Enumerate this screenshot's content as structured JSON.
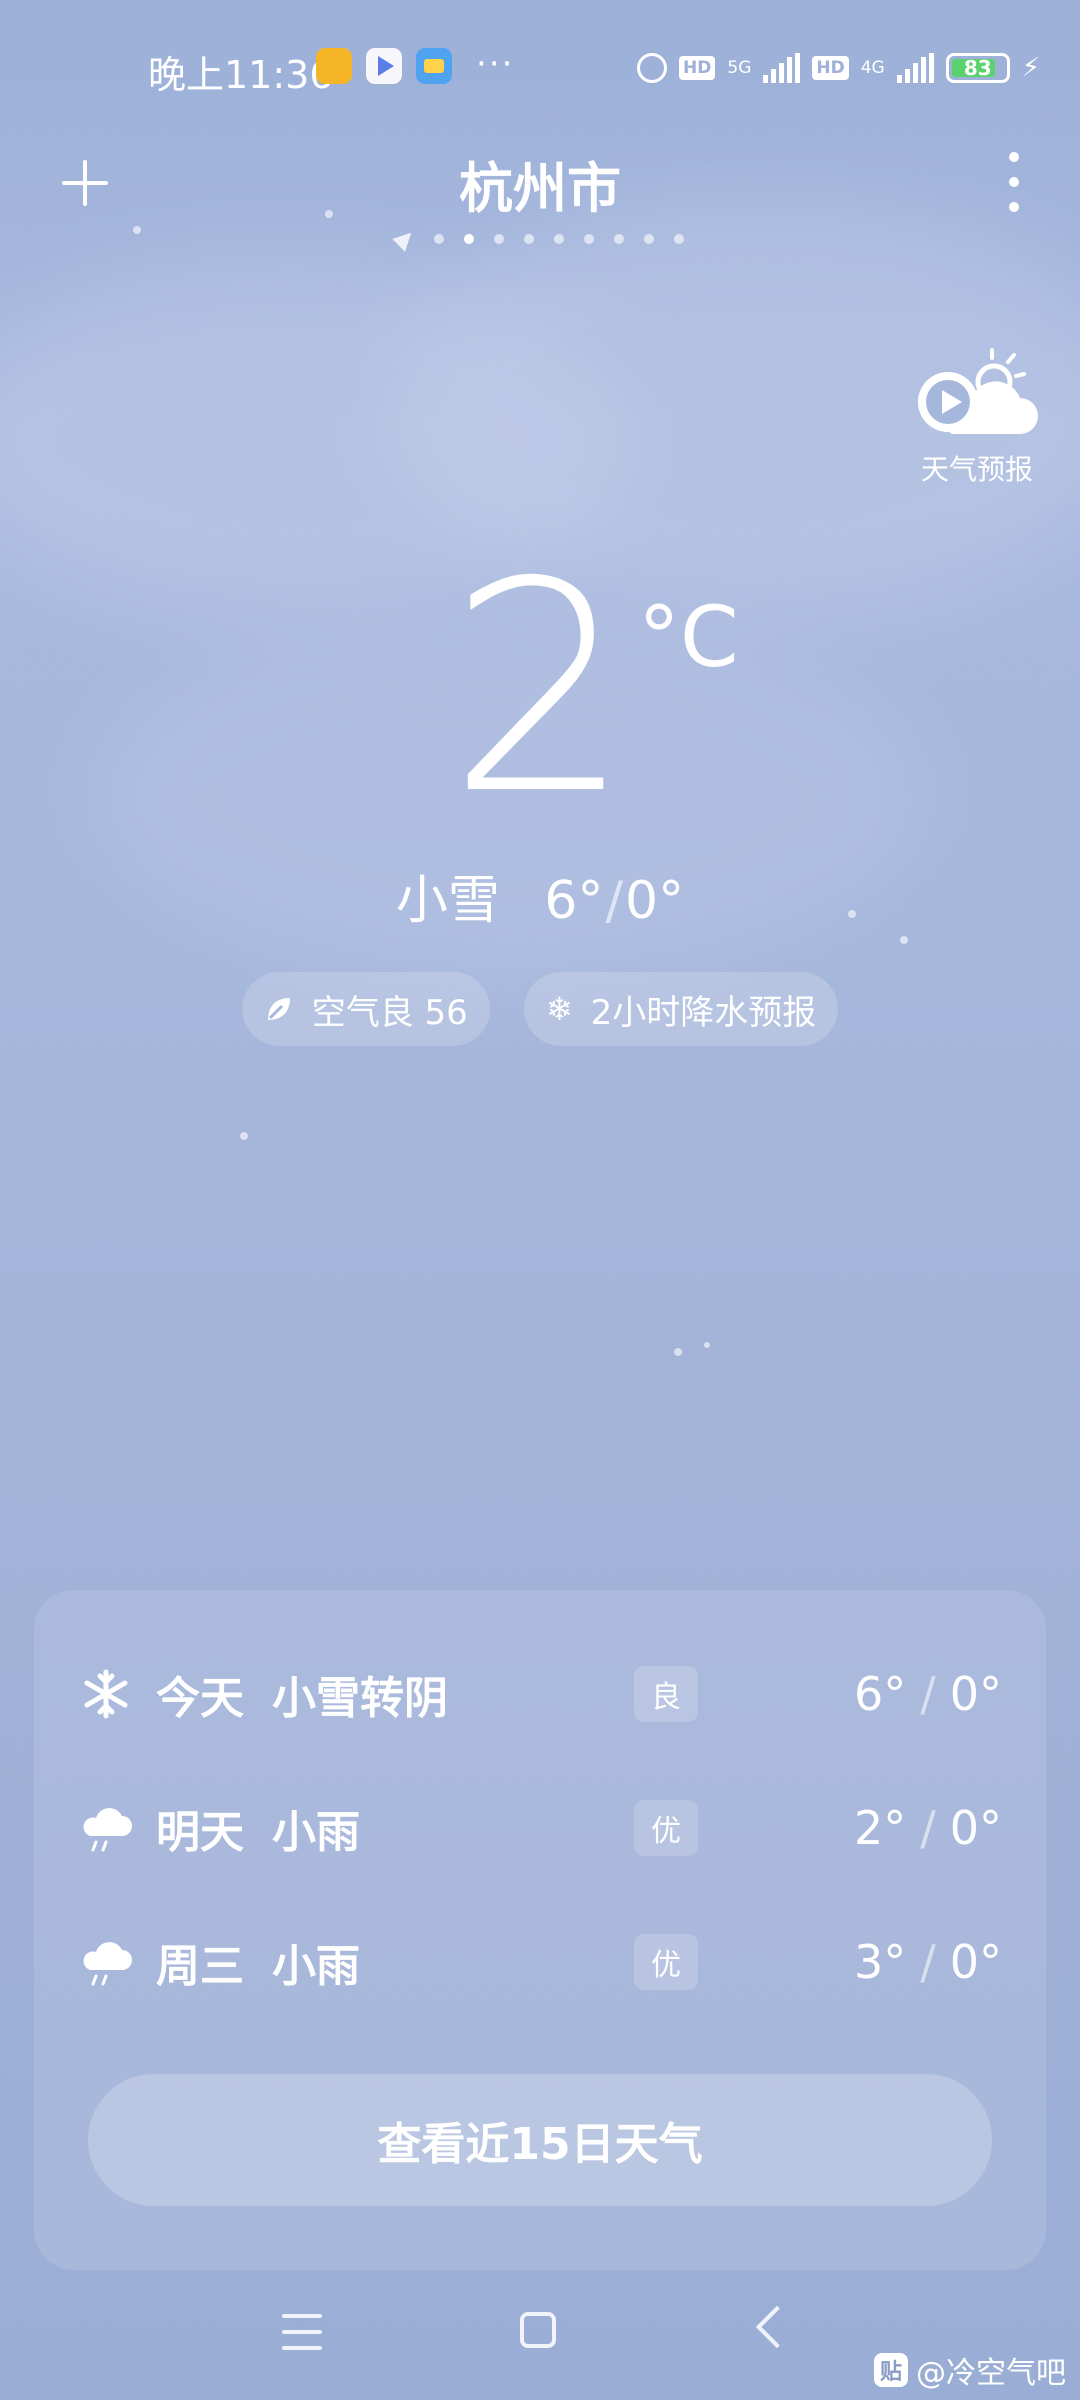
{
  "status_bar": {
    "time": "晚上11:36",
    "more": "···",
    "hd1": "HD",
    "net1": "5G",
    "hd2": "HD",
    "net2": "4G",
    "battery": "83",
    "battery_level": 0.83
  },
  "header": {
    "city": "杭州市",
    "page_count": 9,
    "active_page": 1
  },
  "video_forecast": {
    "label": "天气预报"
  },
  "current": {
    "temperature": "2",
    "unit": "°C",
    "condition": "小雪",
    "high": "6°",
    "low": "0°"
  },
  "pills": {
    "air": "空气良 56",
    "precip": "2小时降水预报"
  },
  "forecast": [
    {
      "day": "今天",
      "desc": "小雪转阴",
      "aqi": "良",
      "high": "6°",
      "low": "0°",
      "icon": "snowflake-icon"
    },
    {
      "day": "明天",
      "desc": "小雨",
      "aqi": "优",
      "high": "2°",
      "low": "0°",
      "icon": "rain-cloud-icon"
    },
    {
      "day": "周三",
      "desc": "小雨",
      "aqi": "优",
      "high": "3°",
      "low": "0°",
      "icon": "rain-cloud-icon"
    }
  ],
  "more_button": "查看近15日天气",
  "watermark": {
    "badge": "贴",
    "text": "@冷空气吧"
  },
  "colors": {
    "background": "#a6b7dc",
    "battery_fill": "#5ad26d"
  }
}
